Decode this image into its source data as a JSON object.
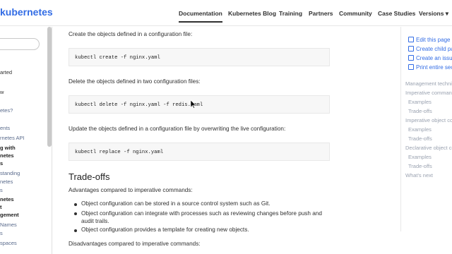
{
  "header": {
    "logo": "kubernetes",
    "nav": [
      "Documentation",
      "Kubernetes Blog",
      "Training",
      "Partners",
      "Community",
      "Case Studies",
      "Versions ▾"
    ]
  },
  "sidebar": {
    "items": [
      "arted",
      "w",
      "etes?",
      "ents",
      "rnetes API",
      "g with",
      "netes",
      "s",
      "standing",
      "netes",
      "s",
      "netes",
      "t",
      "gement",
      "Names",
      "s",
      "spaces"
    ]
  },
  "main": {
    "p1": "Create the objects defined in a configuration file:",
    "code1": "kubectl create -f nginx.yaml",
    "p2": "Delete the objects defined in two configuration files:",
    "code2": "kubectl delete -f nginx.yaml -f redis.yaml",
    "p3": "Update the objects defined in a configuration file by overwriting the live configuration:",
    "code3": "kubectl replace -f nginx.yaml",
    "heading": "Trade-offs",
    "adv_intro": "Advantages compared to imperative commands:",
    "adv": [
      "Object configuration can be stored in a source control system such as Git.",
      "Object configuration can integrate with processes such as reviewing changes before push and audit trails.",
      "Object configuration provides a template for creating new objects."
    ],
    "disadv_intro": "Disadvantages compared to imperative commands:"
  },
  "right": {
    "actions": [
      "Edit this page",
      "Create child pa",
      "Create an issue",
      "Print entire sec"
    ],
    "toc": [
      "Management techni",
      "Imperative comman",
      "Examples",
      "Trade-offs",
      "Imperative object co",
      "Examples",
      "Trade-offs",
      "Declarative object co",
      "Examples",
      "Trade-offs",
      "What's next"
    ]
  }
}
